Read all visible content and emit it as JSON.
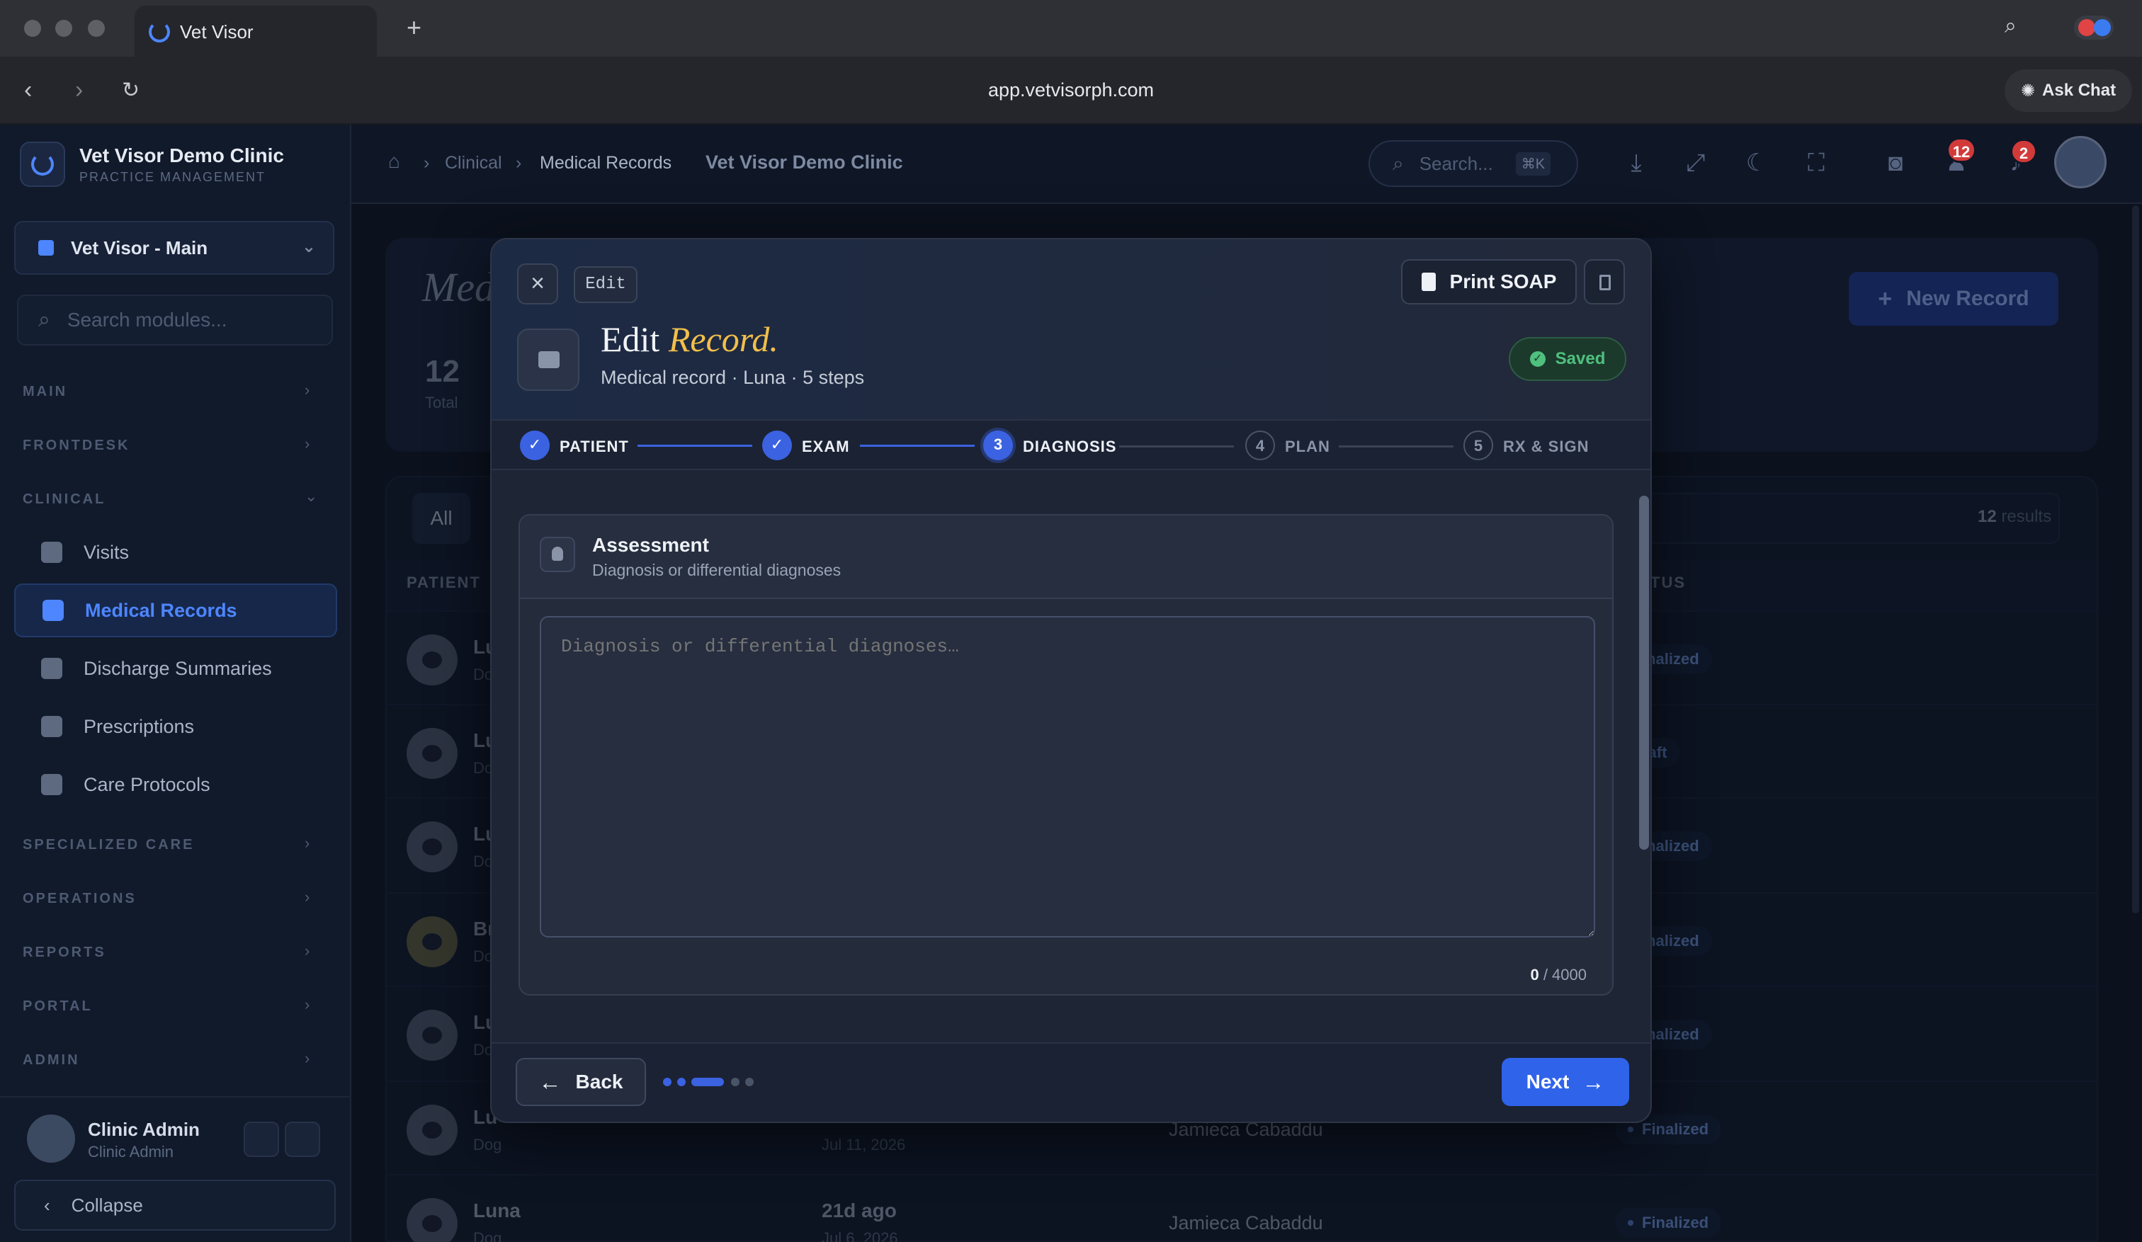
{
  "browser": {
    "tab_title": "Vet Visor",
    "url": "app.vetvisorph.com",
    "ask_chat": "Ask Chat"
  },
  "brand": {
    "name": "Vet Visor Demo Clinic",
    "subtitle": "PRACTICE MANAGEMENT"
  },
  "branch": "Vet Visor - Main",
  "module_search_placeholder": "Search modules...",
  "sidebar": {
    "sections": [
      {
        "label": "MAIN"
      },
      {
        "label": "FRONTDESK"
      },
      {
        "label": "CLINICAL"
      },
      {
        "label": "SPECIALIZED CARE"
      },
      {
        "label": "OPERATIONS"
      },
      {
        "label": "REPORTS"
      },
      {
        "label": "PORTAL"
      },
      {
        "label": "ADMIN"
      }
    ],
    "clinical_items": [
      {
        "label": "Visits"
      },
      {
        "label": "Medical Records"
      },
      {
        "label": "Discharge Summaries"
      },
      {
        "label": "Prescriptions"
      },
      {
        "label": "Care Protocols"
      }
    ],
    "user": {
      "name": "Clinic Admin",
      "role": "Clinic Admin"
    },
    "collapse": "Collapse"
  },
  "header": {
    "breadcrumb": [
      "Clinical",
      "Medical Records"
    ],
    "clinic": "Vet Visor Demo Clinic",
    "search_placeholder": "Search...",
    "search_kbd": "⌘K",
    "badge_users": "12",
    "badge_notifications": "2"
  },
  "page": {
    "title": "Med",
    "total_count": "12",
    "total_label": "Total",
    "new_record": "New Record",
    "filter_all": "All",
    "results_count": "12",
    "results_label": "results",
    "col_patient": "PATIENT",
    "col_status": "TUS",
    "rows": [
      {
        "name": "Lu",
        "sub": "Do",
        "status": "inalized"
      },
      {
        "name": "Lu",
        "sub": "Do",
        "status": "raft"
      },
      {
        "name": "Lu",
        "sub": "Do",
        "status": "inalized"
      },
      {
        "name": "Br",
        "sub": "Do",
        "status": "inalized"
      },
      {
        "name": "Lu",
        "sub": "Do",
        "status": "inalized"
      },
      {
        "name": "Lu",
        "sub": "Dog",
        "date": "",
        "date2": "Jul 11, 2026",
        "doctor": "Jamieca Cabaddu",
        "status": "Finalized"
      },
      {
        "name": "Luna",
        "sub": "Dog",
        "date": "21d ago",
        "date2": "Jul 6, 2026",
        "doctor": "Jamieca Cabaddu",
        "status": "Finalized"
      }
    ]
  },
  "modal": {
    "edit_tag": "Edit",
    "print": "Print SOAP",
    "title_main": "Edit",
    "title_accent": "Record.",
    "subtitle": "Medical record · Luna · 5 steps",
    "saved": "Saved",
    "steps": [
      {
        "num": "✓",
        "label": "PATIENT",
        "state": "done"
      },
      {
        "num": "✓",
        "label": "EXAM",
        "state": "done"
      },
      {
        "num": "3",
        "label": "DIAGNOSIS",
        "state": "current"
      },
      {
        "num": "4",
        "label": "PLAN",
        "state": "todo"
      },
      {
        "num": "5",
        "label": "RX & SIGN",
        "state": "todo"
      }
    ],
    "section_title": "Assessment",
    "section_sub": "Diagnosis or differential diagnoses",
    "textarea_placeholder": "Diagnosis or differential diagnoses…",
    "textarea_value": "",
    "counter_current": "0",
    "counter_max": "/ 4000",
    "back": "Back",
    "next": "Next"
  },
  "colors": {
    "accent": "#3b62e0",
    "saved": "#4fc07e",
    "title_accent": "#f2bf4a"
  }
}
